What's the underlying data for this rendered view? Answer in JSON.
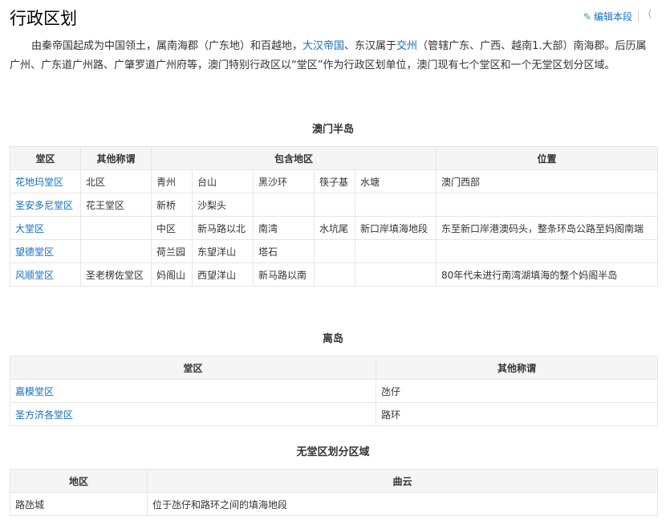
{
  "section": {
    "title": "行政区划",
    "edit_label": "编辑本段",
    "collapse_glyph": "⟨"
  },
  "intro": {
    "p1": "由秦帝国起成为中国领土，属南海郡（广东地）和百越地，",
    "link1": "大汉帝国",
    "p2": "、东汉属于",
    "link2": "交州",
    "p3": "（管辖广东、广西、越南1.大部）南海郡。后历属广州、广东道广州路、广肇罗道广州府等，澳门特别行政区以“堂区”作为行政区划单位，澳门现有七个堂区和一个无堂区划分区域。"
  },
  "macau_peninsula": {
    "caption": "澳门半岛",
    "headers": {
      "parish": "堂区",
      "other_names": "其他称谓",
      "areas": "包含地区",
      "location": "位置"
    },
    "rows": [
      {
        "parish": "花地玛堂区",
        "other": "北区",
        "areas": [
          "青州",
          "台山",
          "黑沙环",
          "筷子基",
          "水塘"
        ],
        "location": "澳门西部"
      },
      {
        "parish": "圣安多尼堂区",
        "other": "花王堂区",
        "areas": [
          "新桥",
          "沙梨头",
          "",
          "",
          ""
        ],
        "location": ""
      },
      {
        "parish": "大堂区",
        "other": "",
        "areas": [
          "中区",
          "新马路以北",
          "南湾",
          "水坑尾",
          "新口岸填海地段"
        ],
        "location": "东至新口岸港澳码头，整条环岛公路至妈阁南端"
      },
      {
        "parish": "望德堂区",
        "other": "",
        "areas": [
          "荷兰园",
          "东望洋山",
          "塔石",
          "",
          ""
        ],
        "location": ""
      },
      {
        "parish": "风顺堂区",
        "other": "圣老楞佐堂区",
        "areas": [
          "妈阁山",
          "西望洋山",
          "新马路以南",
          "",
          ""
        ],
        "location": "80年代未进行南湾湖填海的整个妈阁半岛"
      }
    ]
  },
  "islands": {
    "caption": "离岛",
    "headers": {
      "parish": "堂区",
      "other_names": "其他称谓"
    },
    "rows": [
      {
        "parish": "嘉模堂区",
        "other": "氹仔"
      },
      {
        "parish": "圣方济各堂区",
        "other": "路环"
      }
    ]
  },
  "no_parish": {
    "caption": "无堂区划分区域",
    "headers": {
      "area": "地区",
      "detail": "曲云"
    },
    "rows": [
      {
        "area": "路氹城",
        "detail": "位于氹仔和路环之间的填海地段"
      }
    ]
  }
}
